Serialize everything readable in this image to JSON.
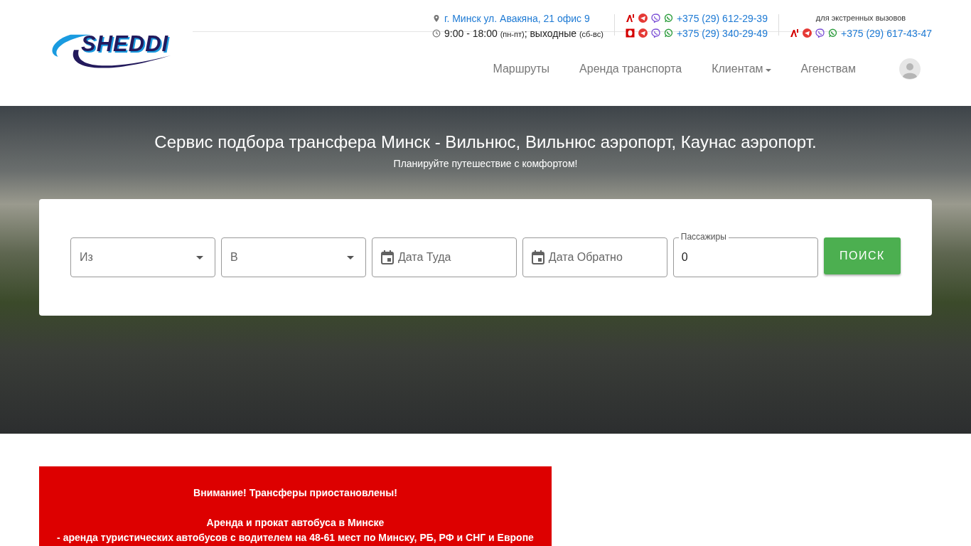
{
  "header": {
    "logo": "SHEDDI",
    "address": "г. Минск ул. Авакяна, 21 офис 9",
    "hours": {
      "time": "9:00 - 18:00",
      "weekdays": "(пн-пт)",
      "weekend": "; выходные",
      "weekend_days": "(сб-вс)"
    },
    "phones": [
      {
        "kind": "a1",
        "number": "+375 (29) 612-29-39"
      },
      {
        "kind": "mts",
        "number": "+375 (29) 340-29-49"
      }
    ],
    "emergency": {
      "label": "для экстренных вызовов",
      "kind": "a1",
      "number": "+375 (29) 617-43-47"
    }
  },
  "nav": [
    {
      "label": "Маршруты",
      "dropdown": false
    },
    {
      "label": "Аренда транспорта",
      "dropdown": false
    },
    {
      "label": "Клиентам",
      "dropdown": true
    },
    {
      "label": "Агенствам",
      "dropdown": false
    }
  ],
  "hero": {
    "title": "Сервис подбора трансфера Минск - Вильнюс, Вильнюс аэропорт, Каунас аэропорт.",
    "subtitle": "Планируйте путешествие с комфортом!"
  },
  "search": {
    "fields": [
      {
        "kind": "select",
        "placeholder": "Из"
      },
      {
        "kind": "select",
        "placeholder": "В"
      },
      {
        "kind": "date",
        "placeholder": "Дата Туда"
      },
      {
        "kind": "date",
        "placeholder": "Дата Обратно"
      },
      {
        "kind": "number",
        "label": "Пассажиры",
        "value": "0"
      }
    ],
    "button": "ПОИСК"
  },
  "notice": {
    "alert": "Внимание! Трансферы приостановлены!",
    "lines": [
      "Аренда и прокат автобуса в Минске",
      "- аренда туристических автобусов с водителем на 48-61 мест по Минску, РБ, РФ и СНГ и Европе"
    ]
  }
}
